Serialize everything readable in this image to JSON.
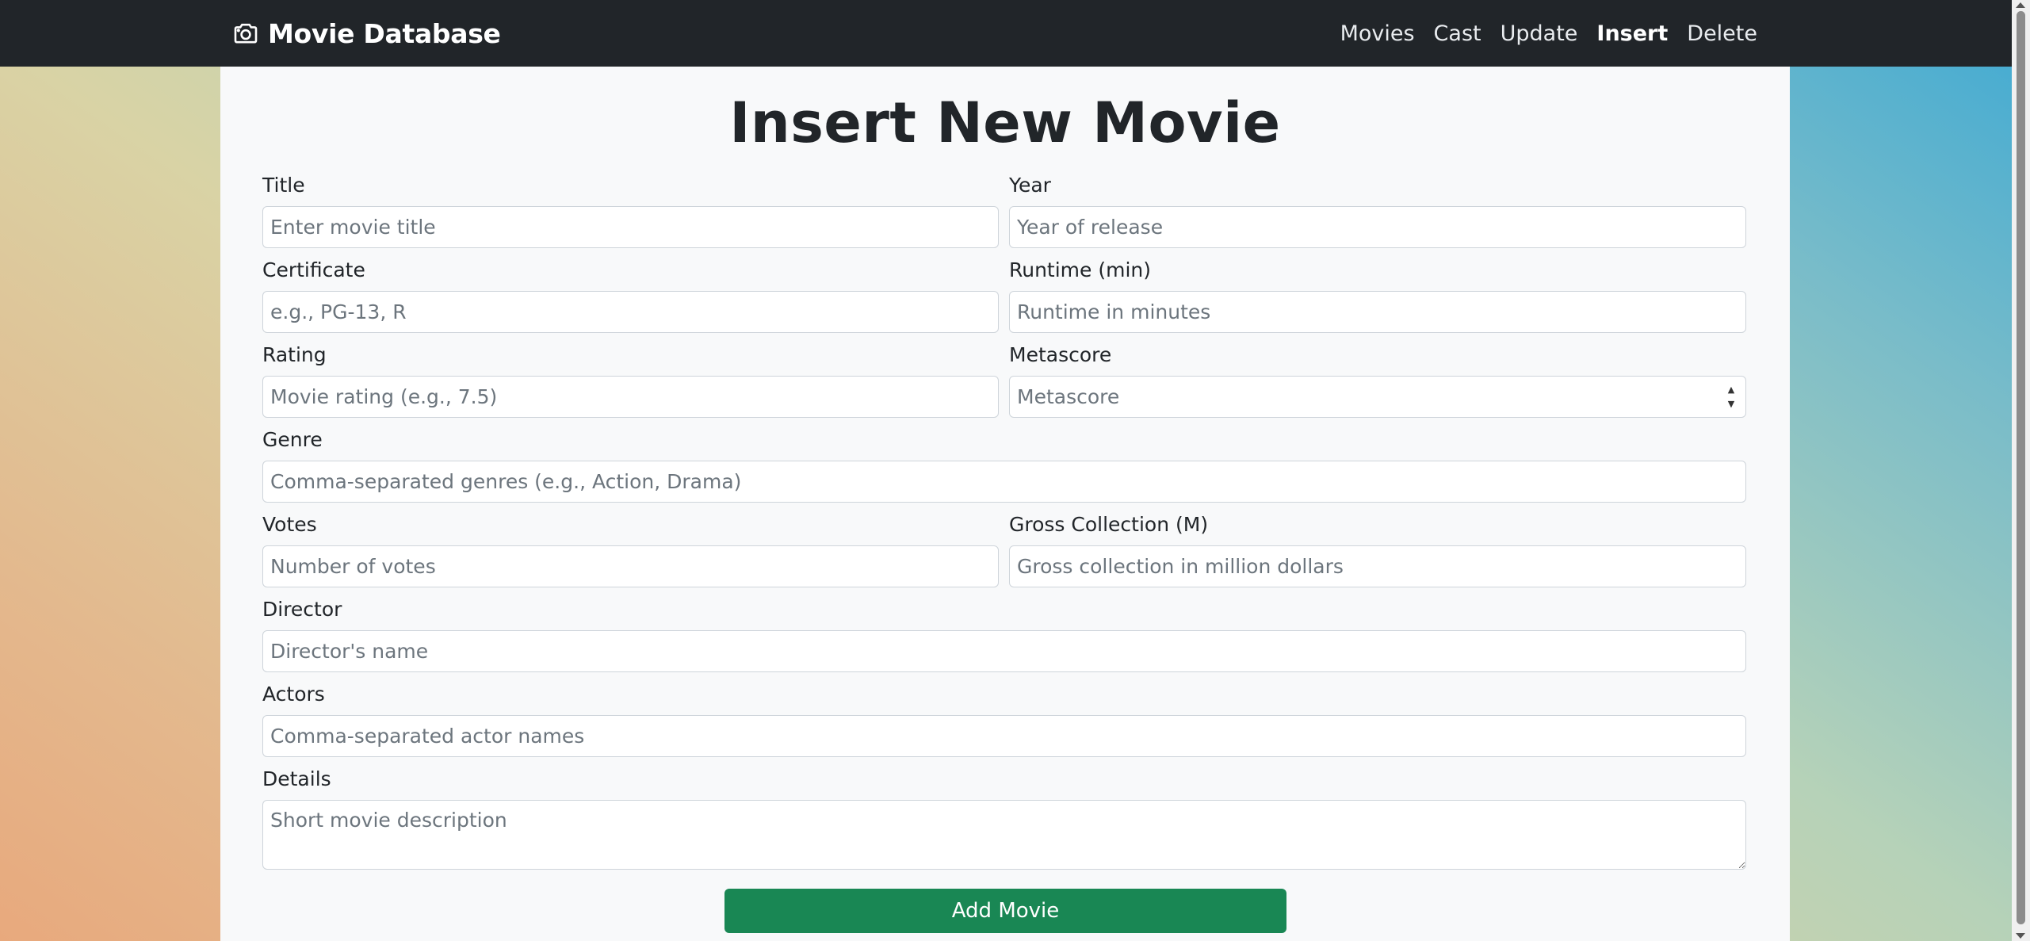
{
  "brand": {
    "title": "Movie Database",
    "icon": "camera-icon"
  },
  "nav": {
    "links": [
      "Movies",
      "Cast",
      "Update",
      "Insert",
      "Delete"
    ],
    "active": "Insert"
  },
  "page": {
    "title": "Insert New Movie"
  },
  "form": {
    "title": {
      "label": "Title",
      "placeholder": "Enter movie title",
      "value": ""
    },
    "year": {
      "label": "Year",
      "placeholder": "Year of release",
      "value": ""
    },
    "certificate": {
      "label": "Certificate",
      "placeholder": "e.g., PG-13, R",
      "value": ""
    },
    "runtime": {
      "label": "Runtime (min)",
      "placeholder": "Runtime in minutes",
      "value": ""
    },
    "rating": {
      "label": "Rating",
      "placeholder": "Movie rating (e.g., 7.5)",
      "value": ""
    },
    "metascore": {
      "label": "Metascore",
      "placeholder": "Metascore",
      "value": ""
    },
    "genre": {
      "label": "Genre",
      "placeholder": "Comma-separated genres (e.g., Action, Drama)",
      "value": ""
    },
    "votes": {
      "label": "Votes",
      "placeholder": "Number of votes",
      "value": ""
    },
    "gross": {
      "label": "Gross Collection (M)",
      "placeholder": "Gross collection in million dollars",
      "value": ""
    },
    "director": {
      "label": "Director",
      "placeholder": "Director's name",
      "value": ""
    },
    "actors": {
      "label": "Actors",
      "placeholder": "Comma-separated actor names",
      "value": ""
    },
    "details": {
      "label": "Details",
      "placeholder": "Short movie description",
      "value": ""
    },
    "submit_label": "Add Movie"
  },
  "colors": {
    "navbar": "#212529",
    "card": "#f8f9fa",
    "submit": "#198754"
  }
}
